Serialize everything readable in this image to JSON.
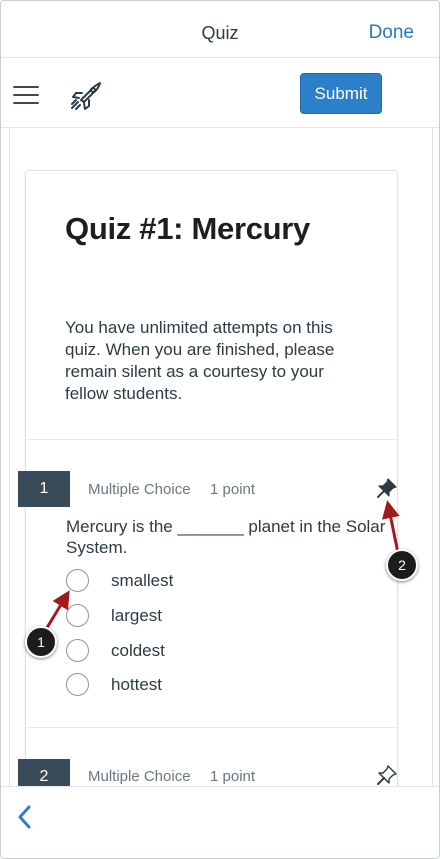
{
  "navbar": {
    "title": "Quiz",
    "done_label": "Done"
  },
  "toolbar": {
    "menu_icon": "hamburger-menu-icon",
    "rocket_icon": "rocket-icon",
    "submit_label": "Submit"
  },
  "quiz": {
    "title": "Quiz #1: Mercury",
    "description": "You have unlimited attempts on this quiz. When you are finished, please remain silent as a courtesy to your fellow students.",
    "questions": [
      {
        "number": "1",
        "type": "Multiple Choice",
        "points": "1 point",
        "pin_icon": "pin-filled-icon",
        "text": "Mercury is the _______ planet in the Solar System.",
        "answers": [
          "smallest",
          "largest",
          "coldest",
          "hottest"
        ]
      },
      {
        "number": "2",
        "type": "Multiple Choice",
        "points": "1 point",
        "pin_icon": "pin-outline-icon"
      }
    ]
  },
  "bottombar": {
    "back_icon": "chevron-left-icon"
  },
  "callouts": [
    "1",
    "2"
  ],
  "colors": {
    "accent": "#2b80c9",
    "link": "#2b7abc",
    "qnum_bg": "#394b58",
    "callout_arrow": "#a31a1a"
  }
}
